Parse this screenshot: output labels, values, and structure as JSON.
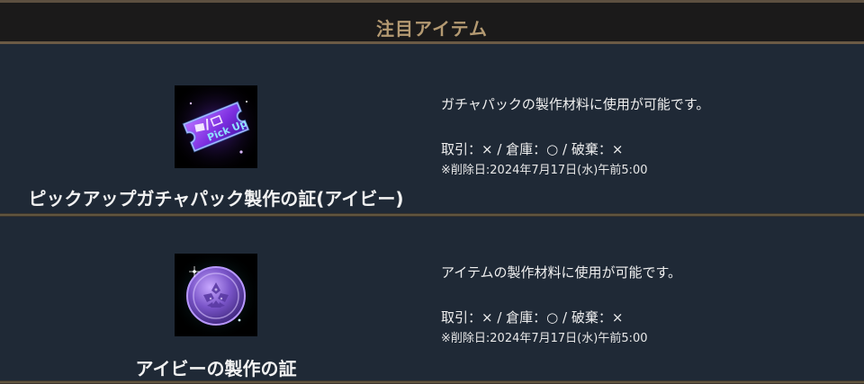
{
  "header": {
    "title": "注目アイテム"
  },
  "items": [
    {
      "name": "ピックアップガチャパック製作の証(アイビー)",
      "description": "ガチャパックの製作材料に使用が可能です。",
      "trade_info": "取引：× / 倉庫：○ / 破棄：×",
      "delete_date": "※削除日:2024年7月17日(水)午前5:00",
      "image_text": "Pick Up",
      "image_icon": "pickup-ticket-icon"
    },
    {
      "name": "アイビーの製作の証",
      "description": "アイテムの製作材料に使用が可能です。",
      "trade_info": "取引：× / 倉庫：○ / 破棄：×",
      "delete_date": "※削除日:2024年7月17日(水)午前5:00",
      "image_icon": "ivy-coin-icon"
    }
  ],
  "colors": {
    "background": "#1f2936",
    "header_background": "#1b1a1a",
    "header_text": "#b49a72",
    "divider": "#61553f",
    "text": "#f0f0f0",
    "ticket_purple": "#8b3fe0",
    "coin_purple": "#7a55c9"
  }
}
